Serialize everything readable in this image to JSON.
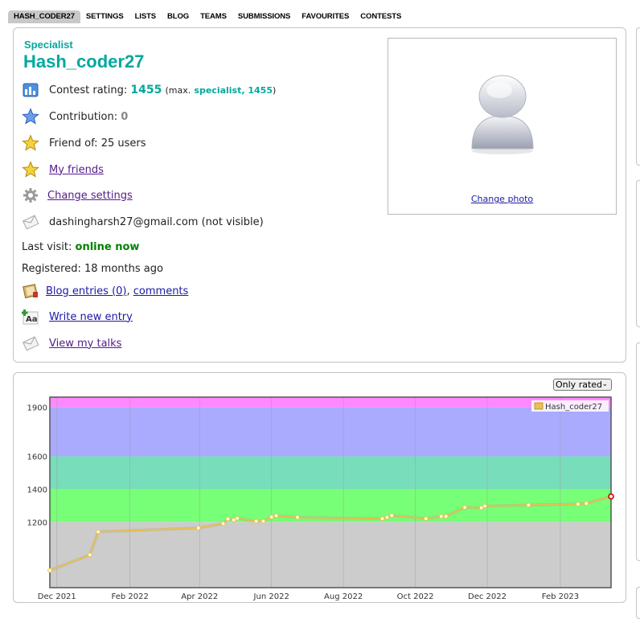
{
  "tabs": [
    "HASH_CODER27",
    "SETTINGS",
    "LISTS",
    "BLOG",
    "TEAMS",
    "SUBMISSIONS",
    "FAVOURITES",
    "CONTESTS"
  ],
  "profile": {
    "rank": "Specialist",
    "handle": "Hash_coder27",
    "rating_label": "Contest rating:",
    "rating": "1455",
    "max_open": "(max.",
    "max_rank": "specialist, 1455",
    "max_close": ")",
    "contribution_label": "Contribution:",
    "contribution": "0",
    "friend_of": "Friend of: 25 users",
    "my_friends": "My friends",
    "change_settings": "Change settings",
    "email": "dashingharsh27@gmail.com (not visible)",
    "last_visit_label": "Last visit:",
    "last_visit": "online now",
    "registered": "Registered: 18 months ago",
    "blog_entries": "Blog entries (0)",
    "comma": ",",
    "comments": "comments",
    "write_entry": "Write new entry",
    "view_talks": "View my talks",
    "change_photo": "Change photo"
  },
  "graph_filter": "Only rated",
  "chart_data": {
    "type": "line",
    "legend": "Hash_coder27",
    "legend_position": "top-right",
    "ylim": [
      800,
      1960
    ],
    "yticks": [
      1200,
      1400,
      1600,
      1900
    ],
    "xticks": [
      "Dec 2021",
      "Feb 2022",
      "Apr 2022",
      "Jun 2022",
      "Aug 2022",
      "Oct 2022",
      "Dec 2022",
      "Feb 2023"
    ],
    "xtick_days": [
      0,
      62,
      121,
      182,
      243,
      304,
      365,
      427
    ],
    "xlim_days": [
      -6,
      470
    ],
    "bands": [
      {
        "from": 800,
        "to": 1200,
        "color": "#cccccc"
      },
      {
        "from": 1200,
        "to": 1400,
        "color": "#77ff77"
      },
      {
        "from": 1400,
        "to": 1600,
        "color": "#77ddbb"
      },
      {
        "from": 1600,
        "to": 1900,
        "color": "#aaaaff"
      },
      {
        "from": 1900,
        "to": 1960,
        "color": "#ff88ff"
      }
    ],
    "series_color": "#e8c14f",
    "points": [
      {
        "day": -6,
        "y": 905
      },
      {
        "day": 28,
        "y": 1000
      },
      {
        "day": 35,
        "y": 1140
      },
      {
        "day": 120,
        "y": 1163
      },
      {
        "day": 141,
        "y": 1190
      },
      {
        "day": 145,
        "y": 1218
      },
      {
        "day": 150,
        "y": 1212
      },
      {
        "day": 153,
        "y": 1222
      },
      {
        "day": 169,
        "y": 1205
      },
      {
        "day": 175,
        "y": 1205
      },
      {
        "day": 182,
        "y": 1230
      },
      {
        "day": 186,
        "y": 1238
      },
      {
        "day": 204,
        "y": 1228
      },
      {
        "day": 276,
        "y": 1220
      },
      {
        "day": 280,
        "y": 1228
      },
      {
        "day": 284,
        "y": 1240
      },
      {
        "day": 313,
        "y": 1220
      },
      {
        "day": 326,
        "y": 1234
      },
      {
        "day": 330,
        "y": 1234
      },
      {
        "day": 346,
        "y": 1289
      },
      {
        "day": 360,
        "y": 1286
      },
      {
        "day": 363,
        "y": 1297
      },
      {
        "day": 400,
        "y": 1303
      },
      {
        "day": 442,
        "y": 1309
      },
      {
        "day": 449,
        "y": 1313
      },
      {
        "day": 470,
        "y": 1355
      }
    ]
  }
}
